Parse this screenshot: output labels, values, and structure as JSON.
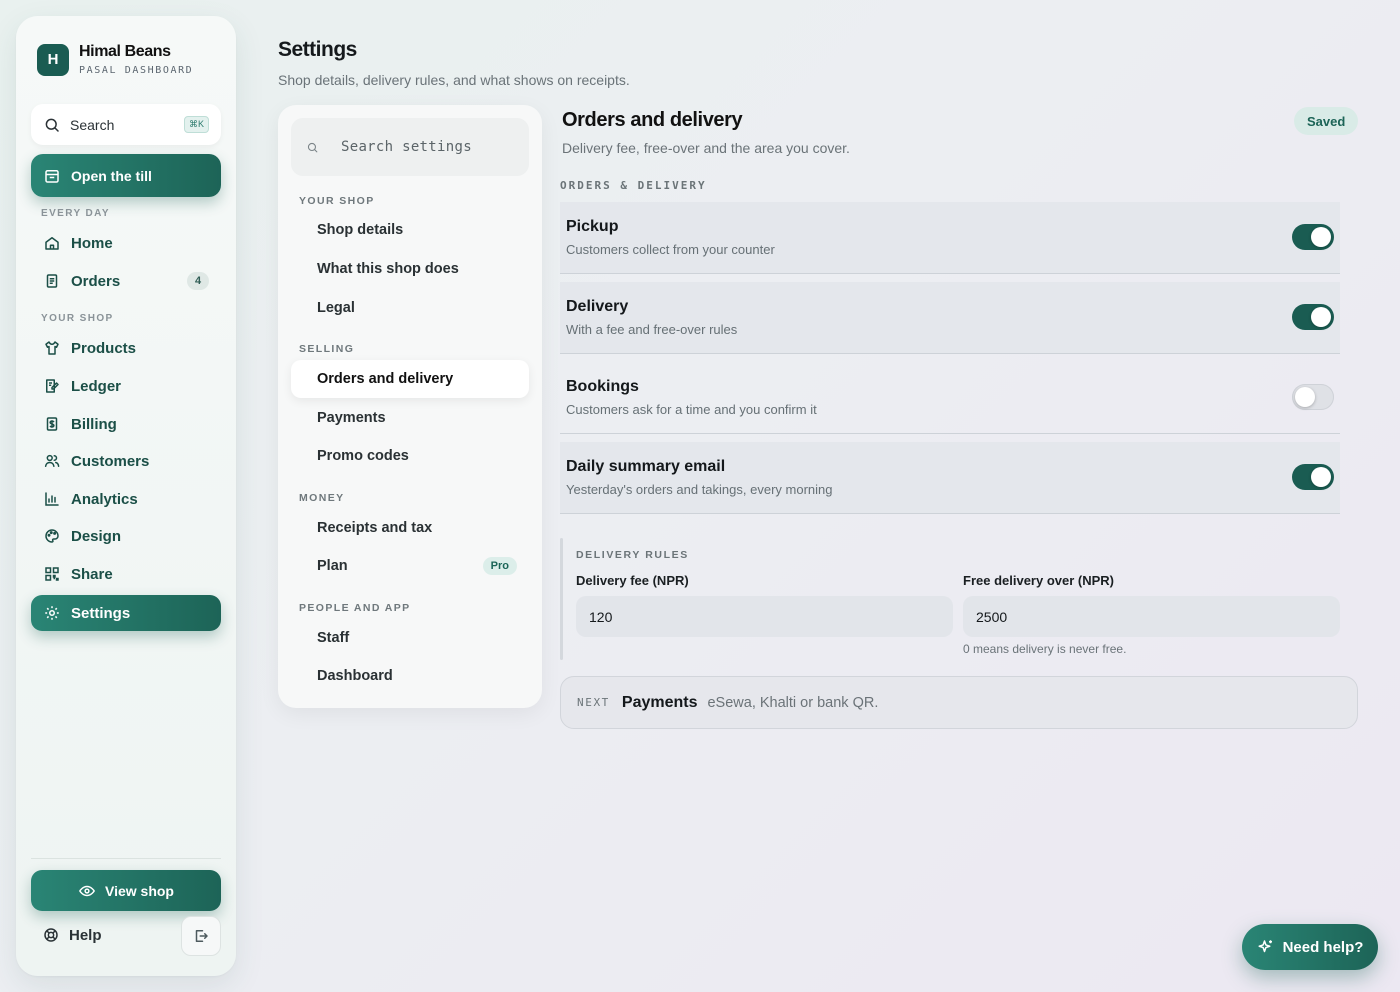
{
  "brand": {
    "initial": "H",
    "name": "Himal Beans",
    "subtitle": "PASAL DASHBOARD"
  },
  "sidebar": {
    "search_label": "Search",
    "search_shortcut": "⌘K",
    "till_label": "Open the till",
    "sections": [
      "EVERY DAY",
      "YOUR SHOP"
    ],
    "items": [
      {
        "label": "Home",
        "icon": "home-icon"
      },
      {
        "label": "Orders",
        "icon": "receipt-icon",
        "count": "4"
      },
      {
        "label": "Products",
        "icon": "shirt-icon"
      },
      {
        "label": "Ledger",
        "icon": "book-edit-icon"
      },
      {
        "label": "Billing",
        "icon": "bill-icon"
      },
      {
        "label": "Customers",
        "icon": "users-icon"
      },
      {
        "label": "Analytics",
        "icon": "bar-chart-icon"
      },
      {
        "label": "Design",
        "icon": "palette-icon"
      },
      {
        "label": "Share",
        "icon": "qr-code-icon"
      },
      {
        "label": "Settings",
        "icon": "gear-icon",
        "active": true
      }
    ],
    "view_shop_label": "View shop",
    "help_label": "Help"
  },
  "header": {
    "title": "Settings",
    "subtitle": "Shop details, delivery rules, and what shows on receipts."
  },
  "settings_nav": {
    "search_placeholder": "Search settings",
    "sections": [
      {
        "label": "YOUR SHOP",
        "items": [
          "Shop details",
          "What this shop does",
          "Legal"
        ]
      },
      {
        "label": "SELLING",
        "items": [
          "Orders and delivery",
          "Payments",
          "Promo codes"
        ]
      },
      {
        "label": "MONEY",
        "items": [
          "Receipts and tax",
          "Plan"
        ]
      },
      {
        "label": "PEOPLE AND APP",
        "items": [
          "Staff",
          "Dashboard"
        ]
      }
    ],
    "active_item": "Orders and delivery",
    "plan_badge": "Pro"
  },
  "main": {
    "title": "Orders and delivery",
    "subtitle": "Delivery fee, free-over and the area you cover.",
    "status": "Saved",
    "group_label": "ORDERS & DELIVERY",
    "toggles": [
      {
        "title": "Pickup",
        "desc": "Customers collect from your counter",
        "on": true
      },
      {
        "title": "Delivery",
        "desc": "With a fee and free-over rules",
        "on": true
      },
      {
        "title": "Bookings",
        "desc": "Customers ask for a time and you confirm it",
        "on": false
      },
      {
        "title": "Daily summary email",
        "desc": "Yesterday's orders and takings, every morning",
        "on": true
      }
    ],
    "rules": {
      "label": "DELIVERY RULES",
      "fee_label": "Delivery fee (NPR)",
      "fee_value": "120",
      "free_label": "Free delivery over (NPR)",
      "free_value": "2500",
      "free_hint": "0 means delivery is never free."
    },
    "next": {
      "kicker": "NEXT",
      "title": "Payments",
      "desc": "eSewa, Khalti or bank QR."
    }
  },
  "help_fab": {
    "label": "Need help?",
    "icon": "sparkle-icon"
  },
  "colors": {
    "accent": "#1d6457",
    "accent_light": "#2a8575",
    "badge_bg": "#d9ebe7"
  }
}
